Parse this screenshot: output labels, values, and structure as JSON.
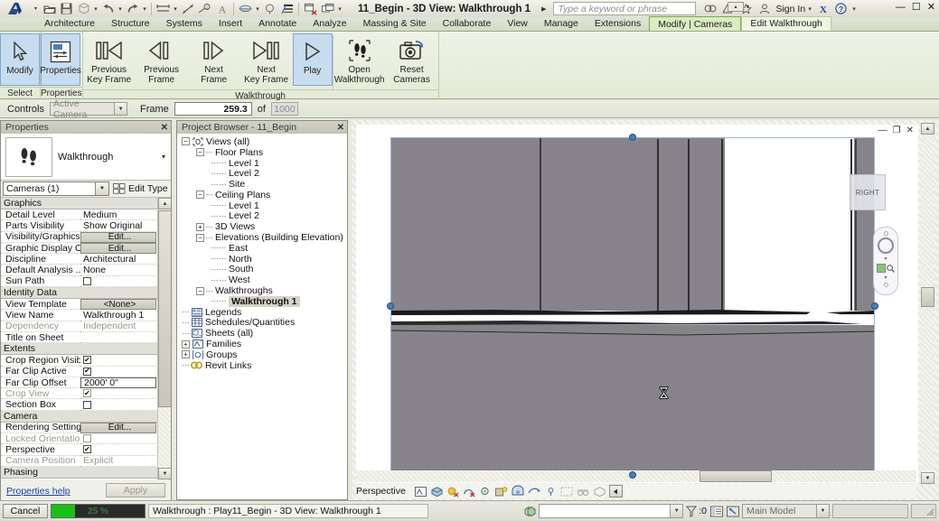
{
  "titlebar": {
    "document_title": "11_Begin - 3D View: Walkthrough 1",
    "search_placeholder": "Type a keyword or phrase",
    "sign_in": "Sign In",
    "quick_access": [
      {
        "name": "open-icon",
        "label": "Open"
      },
      {
        "name": "save-icon",
        "label": "Save"
      },
      {
        "name": "save-as-icon",
        "label": "Save As"
      },
      {
        "name": "undo-icon",
        "label": "Undo"
      },
      {
        "name": "redo-icon",
        "label": "Redo"
      },
      {
        "name": "measure-icon",
        "label": "Measure"
      },
      {
        "name": "aligned-dimension-icon",
        "label": "Aligned Dimension"
      },
      {
        "name": "tag-icon",
        "label": "Tag by Category"
      },
      {
        "name": "text-icon",
        "label": "Text"
      },
      {
        "name": "default-3d-view-icon",
        "label": "Default 3D View"
      },
      {
        "name": "section-icon",
        "label": "Section"
      },
      {
        "name": "thin-lines-icon",
        "label": "Thin Lines"
      },
      {
        "name": "close-hidden-windows-icon",
        "label": "Close Hidden Windows"
      },
      {
        "name": "switch-windows-icon",
        "label": "Switch Windows"
      }
    ],
    "title_icons": [
      {
        "name": "autodesk-360-icon"
      },
      {
        "name": "exchange-apps-icon"
      },
      {
        "name": "favorites-star-icon"
      },
      {
        "name": "user-account-icon"
      }
    ],
    "help_label": "?",
    "window_controls": {
      "minimize": "—",
      "maximize": "☐",
      "close": "✕"
    }
  },
  "ribbon": {
    "tabs": [
      {
        "label": "Architecture",
        "state": "normal"
      },
      {
        "label": "Structure",
        "state": "normal"
      },
      {
        "label": "Systems",
        "state": "normal"
      },
      {
        "label": "Insert",
        "state": "normal"
      },
      {
        "label": "Annotate",
        "state": "normal"
      },
      {
        "label": "Analyze",
        "state": "normal"
      },
      {
        "label": "Massing & Site",
        "state": "normal"
      },
      {
        "label": "Collaborate",
        "state": "normal"
      },
      {
        "label": "View",
        "state": "normal"
      },
      {
        "label": "Manage",
        "state": "normal"
      },
      {
        "label": "Extensions",
        "state": "normal"
      },
      {
        "label": "Modify | Cameras",
        "state": "contextual"
      },
      {
        "label": "Edit Walkthrough",
        "state": "active"
      }
    ],
    "panels": [
      {
        "label": "Select",
        "buttons": [
          {
            "label_line1": "Modify",
            "label_line2": "",
            "icon": "arrow-cursor-icon",
            "selected": true
          }
        ]
      },
      {
        "label": "Properties",
        "buttons": [
          {
            "label_line1": "Properties",
            "label_line2": "",
            "icon": "properties-panel-icon",
            "selected": true
          }
        ]
      },
      {
        "label": "Walkthrough",
        "buttons": [
          {
            "label_line1": "Previous",
            "label_line2": "Key Frame",
            "icon": "previous-key-frame-icon",
            "selected": false
          },
          {
            "label_line1": "Previous",
            "label_line2": "Frame",
            "icon": "previous-frame-icon",
            "selected": false
          },
          {
            "label_line1": "Next",
            "label_line2": "Frame",
            "icon": "next-frame-icon",
            "selected": false
          },
          {
            "label_line1": "Next",
            "label_line2": "Key Frame",
            "icon": "next-key-frame-icon",
            "selected": false
          },
          {
            "label_line1": "Play",
            "label_line2": "",
            "icon": "play-icon",
            "selected": true
          },
          {
            "label_line1": "Open",
            "label_line2": "Walkthrough",
            "icon": "open-walkthrough-footprints-icon",
            "selected": false
          },
          {
            "label_line1": "Reset",
            "label_line2": "Cameras",
            "icon": "reset-cameras-icon",
            "selected": false
          }
        ]
      }
    ]
  },
  "options_bar": {
    "controls_label": "Controls",
    "controls_value": "Active Camera",
    "frame_label": "Frame",
    "frame_value": "259.3",
    "of_label": "of",
    "total_frames": "1000"
  },
  "properties": {
    "panel_title": "Properties",
    "close_label": "✕",
    "thumb_icon": "walkthrough-footprints-icon",
    "type_name": "Walkthrough",
    "selector_value": "Cameras (1)",
    "edit_type_label": "Edit Type",
    "groups": [
      {
        "name": "Graphics",
        "rows": [
          {
            "name": "Detail Level",
            "value": "Medium",
            "kind": "text"
          },
          {
            "name": "Parts Visibility",
            "value": "Show Original",
            "kind": "text"
          },
          {
            "name": "Visibility/Graphics ...",
            "value": "Edit...",
            "kind": "button"
          },
          {
            "name": "Graphic Display O...",
            "value": "Edit...",
            "kind": "button"
          },
          {
            "name": "Discipline",
            "value": "Architectural",
            "kind": "text"
          },
          {
            "name": "Default Analysis ...",
            "value": "None",
            "kind": "text"
          },
          {
            "name": "Sun Path",
            "value": "",
            "kind": "checkbox-off"
          }
        ]
      },
      {
        "name": "Identity Data",
        "rows": [
          {
            "name": "View Template",
            "value": "<None>",
            "kind": "button"
          },
          {
            "name": "View Name",
            "value": "Walkthrough 1",
            "kind": "text"
          },
          {
            "name": "Dependency",
            "value": "Independent",
            "kind": "text-dim"
          },
          {
            "name": "Title on Sheet",
            "value": "",
            "kind": "text"
          }
        ]
      },
      {
        "name": "Extents",
        "rows": [
          {
            "name": "Crop Region Visible",
            "value": "",
            "kind": "checkbox-on"
          },
          {
            "name": "Far Clip Active",
            "value": "",
            "kind": "checkbox-on"
          },
          {
            "name": "Far Clip Offset",
            "value": "2000'  0\"",
            "kind": "boxed"
          },
          {
            "name": "Crop View",
            "value": "",
            "kind": "checkbox-on-dim"
          },
          {
            "name": "Section Box",
            "value": "",
            "kind": "checkbox-off"
          }
        ]
      },
      {
        "name": "Camera",
        "rows": [
          {
            "name": "Rendering Settings",
            "value": "Edit...",
            "kind": "button"
          },
          {
            "name": "Locked Orientation",
            "value": "",
            "kind": "checkbox-off-dim"
          },
          {
            "name": "Perspective",
            "value": "",
            "kind": "checkbox-on"
          },
          {
            "name": "Camera Position",
            "value": "Explicit",
            "kind": "text-dim"
          }
        ]
      },
      {
        "name": "Phasing",
        "rows": []
      }
    ],
    "help_link": "Properties help",
    "apply_label": "Apply"
  },
  "project_browser": {
    "panel_title": "Project Browser - 11_Begin",
    "close_label": "✕",
    "nodes": [
      {
        "label": "Views (all)",
        "depth": 0,
        "expander": "minus",
        "icon": "views-icon",
        "selected": false
      },
      {
        "label": "Floor Plans",
        "depth": 1,
        "expander": "minus",
        "icon": "",
        "selected": false
      },
      {
        "label": "Level 1",
        "depth": 2,
        "expander": "none",
        "icon": "",
        "selected": false
      },
      {
        "label": "Level 2",
        "depth": 2,
        "expander": "none",
        "icon": "",
        "selected": false
      },
      {
        "label": "Site",
        "depth": 2,
        "expander": "none",
        "icon": "",
        "selected": false
      },
      {
        "label": "Ceiling Plans",
        "depth": 1,
        "expander": "minus",
        "icon": "",
        "selected": false
      },
      {
        "label": "Level 1",
        "depth": 2,
        "expander": "none",
        "icon": "",
        "selected": false
      },
      {
        "label": "Level 2",
        "depth": 2,
        "expander": "none",
        "icon": "",
        "selected": false
      },
      {
        "label": "3D Views",
        "depth": 1,
        "expander": "plus",
        "icon": "",
        "selected": false
      },
      {
        "label": "Elevations (Building Elevation)",
        "depth": 1,
        "expander": "minus",
        "icon": "",
        "selected": false
      },
      {
        "label": "East",
        "depth": 2,
        "expander": "none",
        "icon": "",
        "selected": false
      },
      {
        "label": "North",
        "depth": 2,
        "expander": "none",
        "icon": "",
        "selected": false
      },
      {
        "label": "South",
        "depth": 2,
        "expander": "none",
        "icon": "",
        "selected": false
      },
      {
        "label": "West",
        "depth": 2,
        "expander": "none",
        "icon": "",
        "selected": false
      },
      {
        "label": "Walkthroughs",
        "depth": 1,
        "expander": "minus",
        "icon": "",
        "selected": false
      },
      {
        "label": "Walkthrough 1",
        "depth": 2,
        "expander": "none",
        "icon": "",
        "selected": true
      },
      {
        "label": "Legends",
        "depth": 0,
        "expander": "none",
        "icon": "legends-icon",
        "selected": false
      },
      {
        "label": "Schedules/Quantities",
        "depth": 0,
        "expander": "none",
        "icon": "schedules-icon",
        "selected": false
      },
      {
        "label": "Sheets (all)",
        "depth": 0,
        "expander": "none",
        "icon": "sheets-icon",
        "selected": false
      },
      {
        "label": "Families",
        "depth": 0,
        "expander": "plus",
        "icon": "families-icon",
        "selected": false
      },
      {
        "label": "Groups",
        "depth": 0,
        "expander": "plus",
        "icon": "groups-icon",
        "selected": false
      },
      {
        "label": "Revit Links",
        "depth": 0,
        "expander": "none",
        "icon": "revit-links-icon",
        "selected": false
      }
    ]
  },
  "view": {
    "projection_label": "Perspective",
    "viewcube_face": "RIGHT",
    "cursor": "hourglass-cursor",
    "window_buttons": {
      "minimize": "—",
      "restore": "❐",
      "close": "✕"
    },
    "control_icons": [
      {
        "name": "scale-icon"
      },
      {
        "name": "detail-level-icon"
      },
      {
        "name": "visual-style-icon"
      },
      {
        "name": "sun-path-off-icon"
      },
      {
        "name": "shadows-off-icon"
      },
      {
        "name": "rendering-dialog-icon"
      },
      {
        "name": "render-icon"
      },
      {
        "name": "crop-view-icon"
      },
      {
        "name": "show-crop-region-icon"
      },
      {
        "name": "unlock-3d-view-icon"
      },
      {
        "name": "temporary-hide-isolate-icon"
      },
      {
        "name": "reveal-hidden-elements-icon"
      },
      {
        "name": "worksharing-display-icon"
      },
      {
        "name": "expand-toolbar-icon"
      }
    ]
  },
  "status_bar": {
    "cancel_label": "Cancel",
    "progress_percent": "25 %",
    "progress_value": 25,
    "message": "Walkthrough : Play11_Begin - 3D View: Walkthrough 1",
    "filter_count": ":0",
    "workset_value": "Main Model",
    "icons": [
      {
        "name": "worksets-icon"
      },
      {
        "name": "filter-icon"
      },
      {
        "name": "editing-request-icon"
      },
      {
        "name": "design-options-icon"
      }
    ]
  },
  "colors": {
    "ribbon_green": "#d4dbc6",
    "selection_blue": "#c8dcf0",
    "handle_blue": "#4a7ebb",
    "progress_green": "#18c018",
    "link_blue": "#1a3fa8",
    "model_gray": "#86848a"
  }
}
